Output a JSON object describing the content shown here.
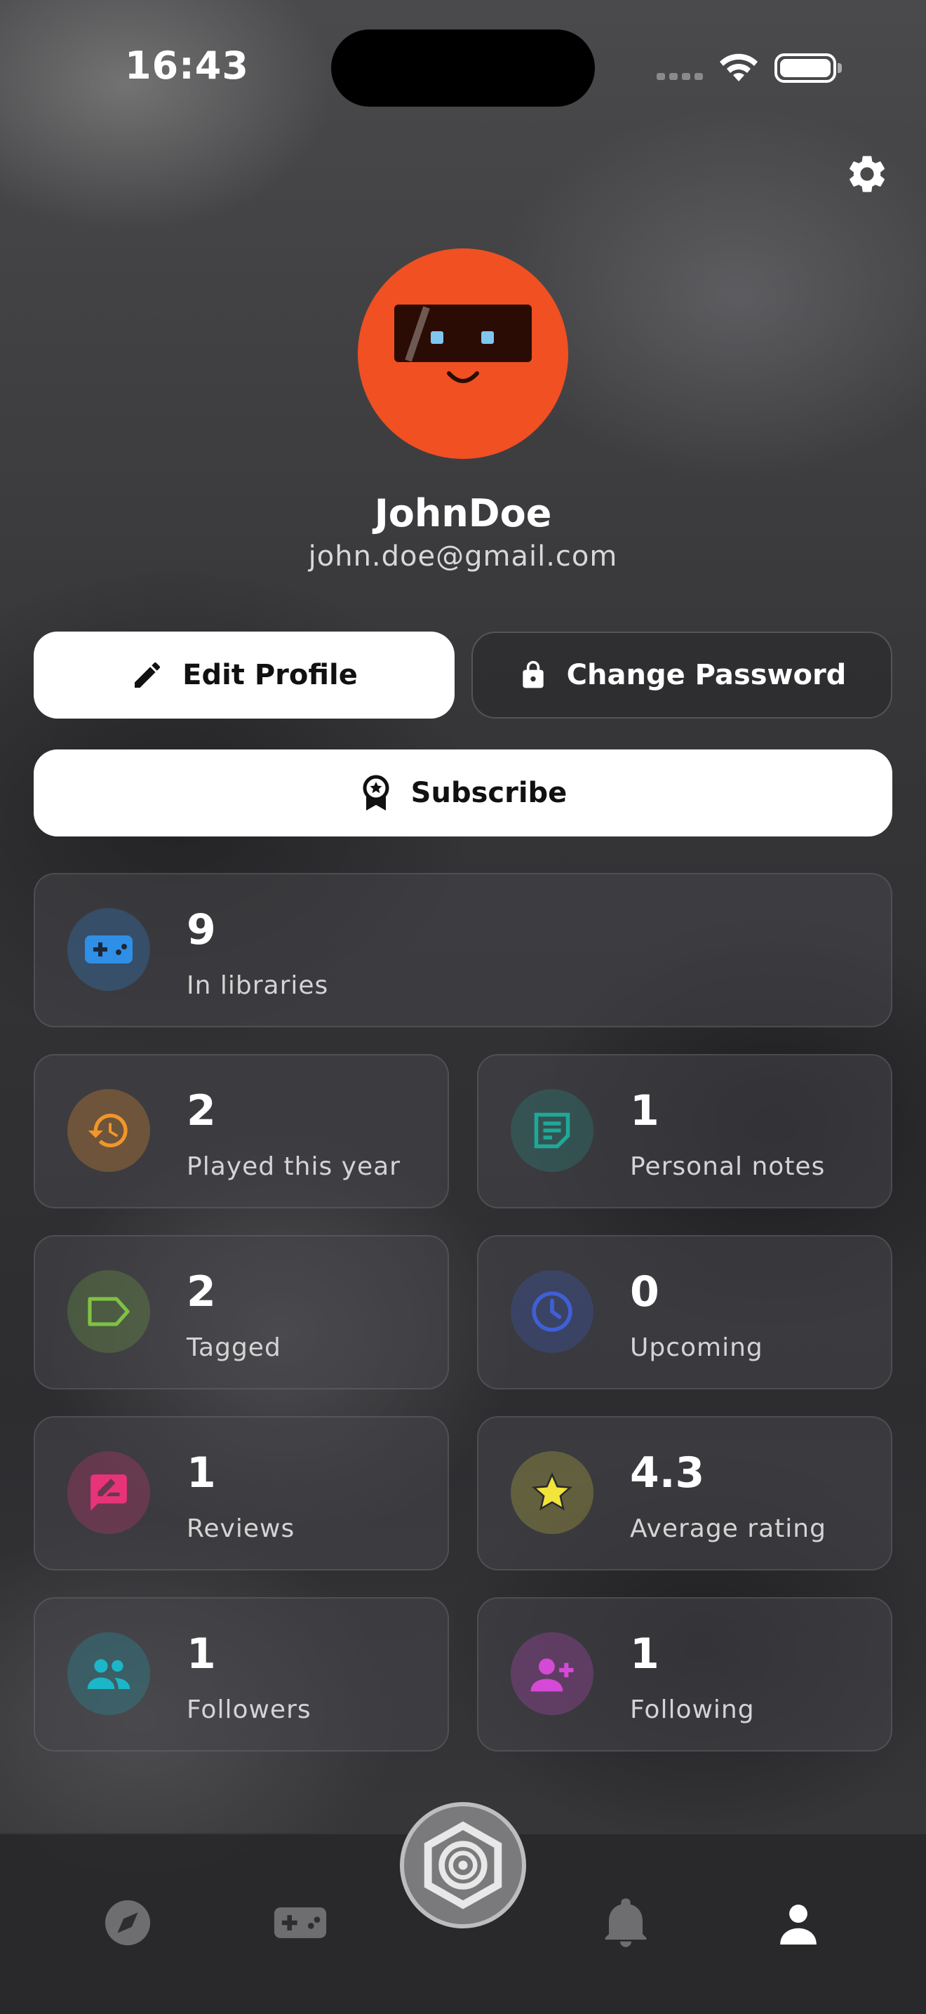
{
  "status_bar": {
    "time": "16:43"
  },
  "profile": {
    "username": "JohnDoe",
    "email": "john.doe@gmail.com"
  },
  "actions": {
    "edit_profile": "Edit Profile",
    "change_password": "Change Password",
    "subscribe": "Subscribe"
  },
  "stats": {
    "libraries": {
      "value": "9",
      "label": "In libraries",
      "icon": "gamepad-icon",
      "color": "#2f8fe6"
    },
    "played": {
      "value": "2",
      "label": "Played this year",
      "icon": "history-icon",
      "color": "#f0962a"
    },
    "notes": {
      "value": "1",
      "label": "Personal notes",
      "icon": "note-icon",
      "color": "#1fa898"
    },
    "tagged": {
      "value": "2",
      "label": "Tagged",
      "icon": "tag-icon",
      "color": "#7ec243"
    },
    "upcoming": {
      "value": "0",
      "label": "Upcoming",
      "icon": "clock-icon",
      "color": "#3f5fd4"
    },
    "reviews": {
      "value": "1",
      "label": "Reviews",
      "icon": "review-icon",
      "color": "#e8337a"
    },
    "rating": {
      "value": "4.3",
      "label": "Average rating",
      "icon": "star-icon",
      "color": "#f2e43a"
    },
    "followers": {
      "value": "1",
      "label": "Followers",
      "icon": "people-icon",
      "color": "#1cb6c8"
    },
    "following": {
      "value": "1",
      "label": "Following",
      "icon": "person-add-icon",
      "color": "#d44ad6"
    }
  },
  "nav": {
    "items": [
      "explore-icon",
      "gamepad-icon",
      "home-logo-icon",
      "bell-icon",
      "profile-icon"
    ],
    "active": "profile"
  }
}
